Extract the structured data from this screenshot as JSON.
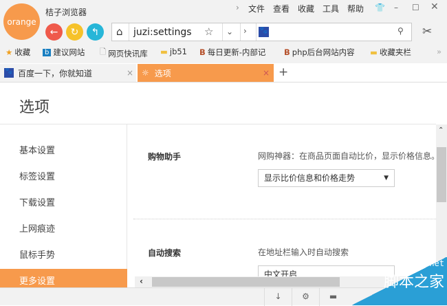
{
  "window": {
    "logo": "orange",
    "title": "桔子浏览器",
    "menu": [
      "文件",
      "查看",
      "收藏",
      "工具",
      "帮助"
    ]
  },
  "address": {
    "url": "juzi:settings",
    "search_placeholder": ""
  },
  "bookmarks": [
    "收藏",
    "建议网站",
    "网页快讯库",
    "jb51",
    "每日更新-内部记",
    "php后台网站内容",
    "收藏夹栏"
  ],
  "tabs": [
    {
      "label": "百度一下，你就知道",
      "active": false
    },
    {
      "label": "选项",
      "active": true
    }
  ],
  "page": {
    "title": "选项"
  },
  "sidebar": [
    "基本设置",
    "标签设置",
    "下载设置",
    "上网痕迹",
    "鼠标手势",
    "更多设置"
  ],
  "sections": [
    {
      "label": "购物助手",
      "desc": "网购神器：在商品页面自动比价，显示价格信息。",
      "select": "显示比价信息和价格走势"
    },
    {
      "label": "自动搜索",
      "desc": "在地址栏输入时自动搜索",
      "select": "中文开启"
    }
  ],
  "watermark": {
    "site": "jb51.net",
    "name": "脚本之家"
  },
  "colors": {
    "accent": "#f79a4c"
  }
}
